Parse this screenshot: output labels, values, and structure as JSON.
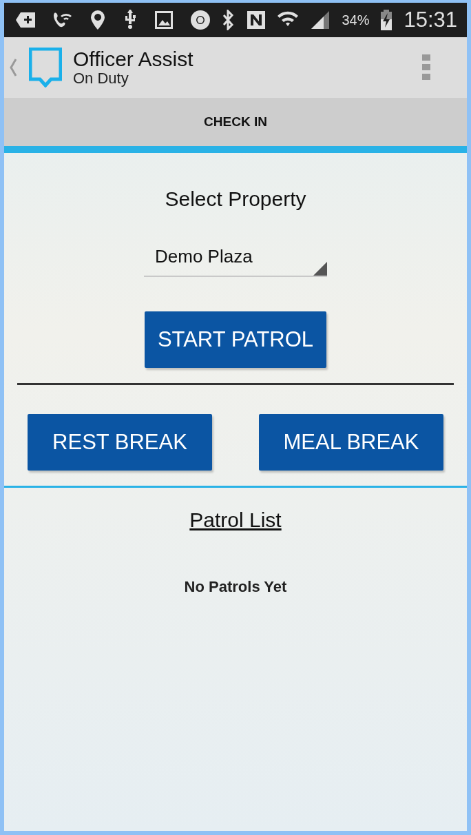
{
  "status_bar": {
    "battery": "34%",
    "time": "15:31"
  },
  "app_bar": {
    "title": "Officer Assist",
    "subtitle": "On Duty"
  },
  "tabs": [
    {
      "label": "CHECK IN",
      "selected": true
    }
  ],
  "property": {
    "heading": "Select Property",
    "value": "Demo Plaza"
  },
  "buttons": {
    "start": "START PATROL",
    "rest": "REST BREAK",
    "meal": "MEAL BREAK"
  },
  "patrol_list": {
    "heading": "Patrol List",
    "empty": "No Patrols Yet"
  }
}
